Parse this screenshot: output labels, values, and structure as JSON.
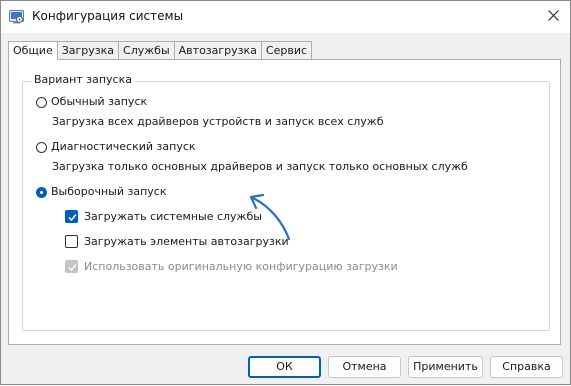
{
  "window": {
    "title": "Конфигурация системы",
    "icon": "msconfig-icon"
  },
  "tabs": [
    {
      "label": "Общие",
      "active": true
    },
    {
      "label": "Загрузка",
      "active": false
    },
    {
      "label": "Службы",
      "active": false
    },
    {
      "label": "Автозагрузка",
      "active": false
    },
    {
      "label": "Сервис",
      "active": false
    }
  ],
  "startup": {
    "group_label": "Вариант запуска",
    "options": [
      {
        "label": "Обычный запуск",
        "description": "Загрузка всех драйверов устройств и запуск всех служб",
        "selected": false
      },
      {
        "label": "Диагностический запуск",
        "description": "Загрузка только основных драйверов и запуск только основных служб",
        "selected": false
      },
      {
        "label": "Выборочный запуск",
        "selected": true
      }
    ],
    "selective": {
      "load_services": {
        "label": "Загружать системные службы",
        "checked": true
      },
      "load_startup": {
        "label": "Загружать элементы автозагрузки",
        "checked": false
      },
      "use_original": {
        "label": "Использовать оригинальную конфигурацию загрузки",
        "checked": true,
        "disabled": true
      }
    }
  },
  "buttons": {
    "ok": "ОК",
    "cancel": "Отмена",
    "apply": "Применить",
    "help": "Справка"
  },
  "colors": {
    "accent": "#005fb8",
    "annotation_arrow": "#2a6fc4"
  }
}
